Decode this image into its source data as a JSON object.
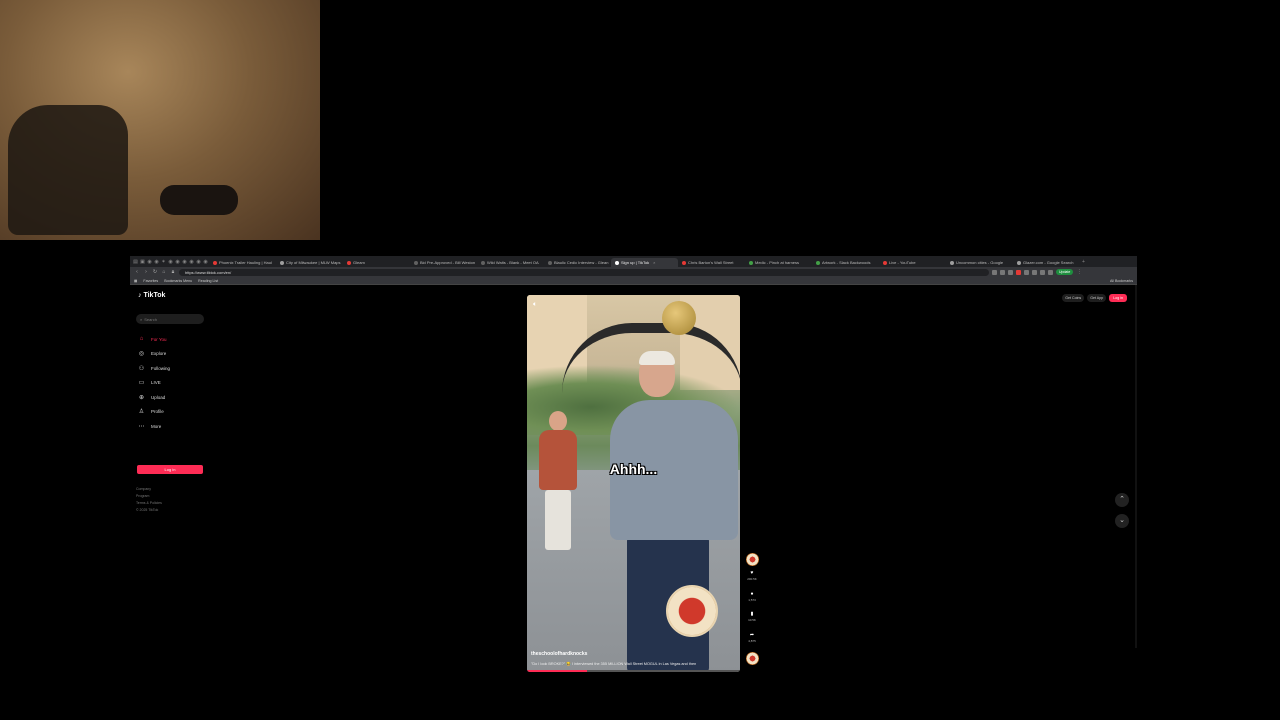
{
  "tabs": [
    {
      "label": "Phoenix Trailer Hauling | Haul",
      "color": "#e53935",
      "active": false
    },
    {
      "label": "City of Milwaukee | MLW Maps",
      "color": "#9e9e9e",
      "active": false
    },
    {
      "label": "Gleam",
      "color": "#e53935",
      "active": false
    },
    {
      "label": "Bid Pre-Approved - Bill Weston",
      "color": "#616161",
      "active": false
    },
    {
      "label": "Wild Walts - Blank - Meet OA",
      "color": "#616161",
      "active": false
    },
    {
      "label": "Blaulic Cedic Interview - Glean",
      "color": "#616161",
      "active": false
    },
    {
      "label": "Sign up | TikTok",
      "color": "#ffffff",
      "active": true
    },
    {
      "label": "Chris Barton's Wall Street",
      "color": "#e53935",
      "active": false
    },
    {
      "label": "Medic - Pinch at harness",
      "color": "#43a047",
      "active": false
    },
    {
      "label": "Artwork - Slack Backwoods",
      "color": "#43a047",
      "active": false
    },
    {
      "label": "Live - YouTube",
      "color": "#e53935",
      "active": false
    },
    {
      "label": "Uncommon cities - Google",
      "color": "#9e9e9e",
      "active": false
    },
    {
      "label": "Glazer.com - Google Search",
      "color": "#9e9e9e",
      "active": false
    }
  ],
  "address": {
    "url": "https://www.tiktok.com/en/",
    "update_label": "Update"
  },
  "bookmarks": {
    "items": [
      "Favorites",
      "Bookmarks Menu",
      "Reading List"
    ],
    "all_label": "All Bookmarks"
  },
  "tiktok": {
    "logo": "TikTok",
    "search_placeholder": "Search",
    "nav": [
      {
        "label": "For You",
        "icon": "home-icon",
        "glyph": "⌂",
        "active": true
      },
      {
        "label": "Explore",
        "icon": "compass-icon",
        "glyph": "◎",
        "active": false
      },
      {
        "label": "Following",
        "icon": "following-icon",
        "glyph": "⚇",
        "active": false
      },
      {
        "label": "LIVE",
        "icon": "live-icon",
        "glyph": "▭",
        "active": false
      },
      {
        "label": "Upload",
        "icon": "upload-icon",
        "glyph": "⊕",
        "active": false
      },
      {
        "label": "Profile",
        "icon": "profile-icon",
        "glyph": "♙",
        "active": false
      },
      {
        "label": "More",
        "icon": "more-icon",
        "glyph": "⋯",
        "active": false
      }
    ],
    "login_label": "Log in",
    "footer": [
      "Company",
      "Program",
      "Terms & Policies",
      "© 2025 TikTok"
    ],
    "top_right": {
      "coins": "Get Coins",
      "app": "Get App",
      "login": "Log in"
    },
    "video": {
      "caption": "Ahhh...",
      "username": "theschoolofhardknocks",
      "description": "\"Do I look BROKE?\" 😂 I interviewed the 355 MILLION Wall Street MOGUL in Las Vegas and then",
      "progress": 0.28
    },
    "actions": [
      {
        "name": "like-icon",
        "glyph": "♥",
        "count": "200.5K"
      },
      {
        "name": "comment-icon",
        "glyph": "●",
        "count": "1,573"
      },
      {
        "name": "bookmark-icon",
        "glyph": "▮",
        "count": "10.5K"
      },
      {
        "name": "share-icon",
        "glyph": "➦",
        "count": "4,875"
      }
    ]
  }
}
